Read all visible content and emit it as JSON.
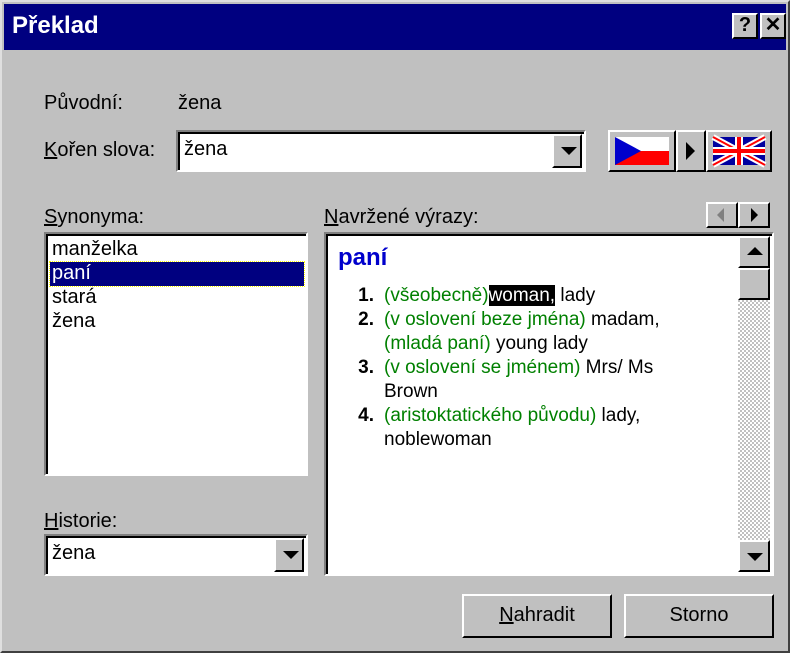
{
  "window": {
    "title": "Překlad",
    "help_label": "?",
    "close_label": "✕"
  },
  "original": {
    "label": "Původní:",
    "value": "žena"
  },
  "root": {
    "label_accel": "K",
    "label_rest": "ořen slova:",
    "value": "žena"
  },
  "direction": {
    "from": "czech-flag",
    "to": "uk-flag"
  },
  "synonyms": {
    "label_accel": "S",
    "label_rest": "ynonyma:",
    "items": [
      "manželka",
      "paní",
      "stará",
      "žena"
    ],
    "selected_index": 1
  },
  "history": {
    "label_accel": "H",
    "label_rest": "istorie:",
    "value": "žena"
  },
  "suggestions": {
    "label_accel": "N",
    "label_rest": "avržené výrazy:",
    "headword": "paní",
    "entries": [
      {
        "num": "1.",
        "l1_note": "(všeobecně)",
        "l1_hl": "woman,",
        "l1_rest": " lady"
      },
      {
        "num": "2.",
        "l1_note": "(v oslovení beze jména)",
        "l1_rest": " madam,",
        "l2_note": "(mladá paní)",
        "l2_rest": "  young lady"
      },
      {
        "num": "3.",
        "l1_note": "(v oslovení se jménem)",
        "l1_rest": " Mrs/ Ms",
        "l2_rest": "Brown"
      },
      {
        "num": "4.",
        "l1_note": "(aristoktatického původu)",
        "l1_rest": " lady,",
        "l2_rest": "noblewoman"
      }
    ]
  },
  "buttons": {
    "replace_accel": "N",
    "replace_rest": "ahradit",
    "cancel": "Storno"
  }
}
